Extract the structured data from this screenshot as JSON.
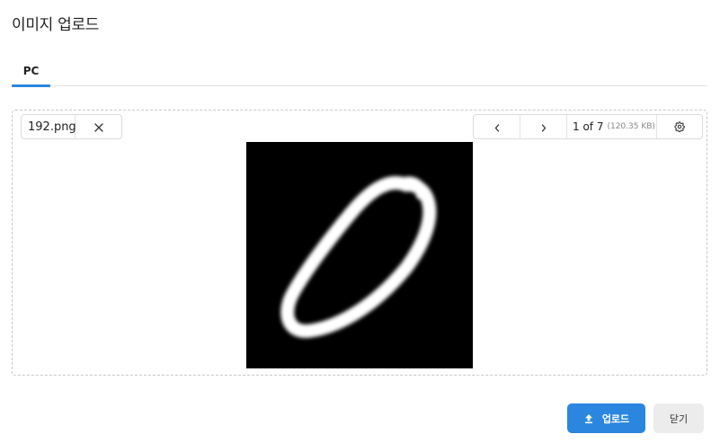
{
  "dialog": {
    "title": "이미지 업로드"
  },
  "tabs": [
    {
      "label": "PC",
      "active": true
    }
  ],
  "file": {
    "name": "192.png",
    "remove_icon": "close-icon"
  },
  "pager": {
    "prev_icon": "chevron-left-icon",
    "next_icon": "chevron-right-icon",
    "page_text": "1 of 7",
    "size_text": "(120.35 KB)",
    "settings_icon": "gear-icon"
  },
  "preview": {
    "image_icon": "handwritten-digit-zero-image"
  },
  "footer": {
    "upload_label": "업로드",
    "upload_icon": "upload-icon",
    "close_label": "닫기"
  },
  "colors": {
    "accent": "#2b86e0",
    "close_button_bg": "#ececec",
    "preview_bg": "#000000"
  }
}
